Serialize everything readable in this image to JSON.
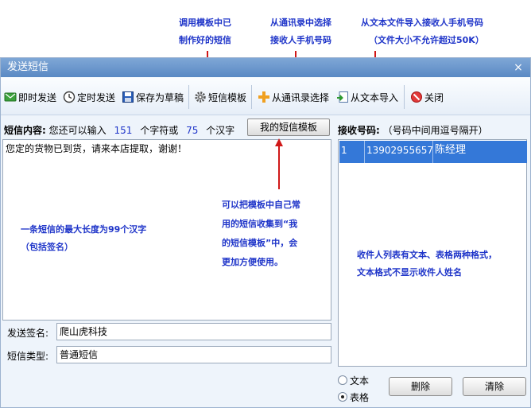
{
  "annotations": {
    "template_tip_line1": "调用模板中已",
    "template_tip_line2": "制作好的短信",
    "contacts_tip_line1": "从通讯录中选择",
    "contacts_tip_line2": "接收人手机号码",
    "import_tip_line1": "从文本文件导入接收人手机号码",
    "import_tip_line2": "（文件大小不允许超过50K）",
    "favorite_tip_line1": "可以把模板中自己常",
    "favorite_tip_line2": "用的短信收集到“我",
    "favorite_tip_line3": "的短信模板”中，会",
    "favorite_tip_line4": "更加方便使用。",
    "length_tip_line1": "一条短信的最大长度为99个汉字",
    "length_tip_line2": "（包括签名）",
    "list_tip_line1": "收件人列表有文本、表格两种格式，",
    "list_tip_line2": "文本格式不显示收件人姓名"
  },
  "window": {
    "title": "发送短信",
    "close": "×"
  },
  "toolbar": {
    "send_now": "即时发送",
    "send_timed": "定时发送",
    "save_draft": "保存为草稿",
    "sms_template": "短信模板",
    "from_contacts": "从通讯录选择",
    "from_text": "从文本导入",
    "close": "关闭"
  },
  "content": {
    "label": "短信内容:",
    "remain_prefix": "您还可以输入",
    "chars_left": "151",
    "chars_unit": "个字符或",
    "hanzi_left": "75",
    "hanzi_unit": "个汉字",
    "my_template_button": "我的短信模板",
    "message": "您定的货物已到货，请来本店提取，谢谢！"
  },
  "signature": {
    "label": "发送签名:",
    "value": "爬山虎科技"
  },
  "sms_type": {
    "label": "短信类型:",
    "value": "普通短信"
  },
  "recipients": {
    "label": "接收号码:",
    "hint": "（号码中间用逗号隔开）",
    "rows": [
      {
        "index": "1",
        "phone": "13902955657",
        "name": "陈经理"
      }
    ]
  },
  "format": {
    "text_option": "文本",
    "table_option": "表格",
    "selected": "table"
  },
  "buttons": {
    "delete": "删除",
    "clear": "清除"
  }
}
